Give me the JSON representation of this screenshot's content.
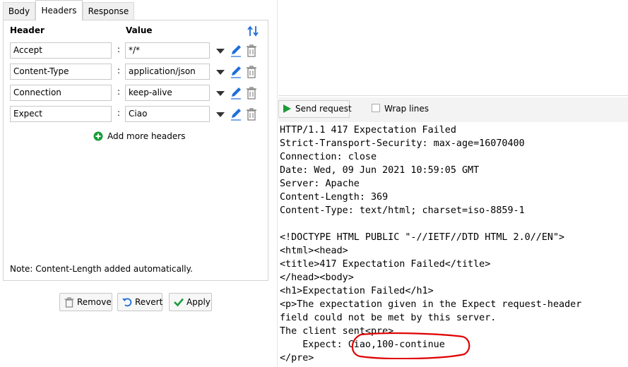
{
  "tabs": [
    {
      "label": "Body"
    },
    {
      "label": "Headers"
    },
    {
      "label": "Response"
    }
  ],
  "columns": {
    "header": "Header",
    "value": "Value"
  },
  "headers": [
    {
      "name": "Accept",
      "value": "*/*"
    },
    {
      "name": "Content-Type",
      "value": "application/json"
    },
    {
      "name": "Connection",
      "value": "keep-alive"
    },
    {
      "name": "Expect",
      "value": "Ciao"
    }
  ],
  "separator": ":",
  "add_more_label": "Add more headers",
  "note": "Note: Content-Length added automatically.",
  "buttons": {
    "remove": "Remove",
    "revert": "Revert",
    "apply": "Apply"
  },
  "toolbar": {
    "send_label": "Send request",
    "wrap_label": "Wrap lines",
    "wrap_checked": false
  },
  "response_lines": [
    "HTTP/1.1 417 Expectation Failed",
    "Strict-Transport-Security: max-age=16070400",
    "Connection: close",
    "Date: Wed, 09 Jun 2021 10:59:05 GMT",
    "Server: Apache",
    "Content-Length: 369",
    "Content-Type: text/html; charset=iso-8859-1",
    "",
    "<!DOCTYPE HTML PUBLIC \"-//IETF//DTD HTML 2.0//EN\">",
    "<html><head>",
    "<title>417 Expectation Failed</title>",
    "</head><body>",
    "<h1>Expectation Failed</h1>",
    "<p>The expectation given in the Expect request-header",
    "field could not be met by this server.",
    "The client sent<pre>",
    "    Expect: Ciao,100-continue",
    "</pre>"
  ],
  "colors": {
    "accent_blue": "#1e6fd9",
    "add_green": "#1a9c3a",
    "send_green": "#1a9c3a",
    "annotation_red": "#e00000"
  }
}
